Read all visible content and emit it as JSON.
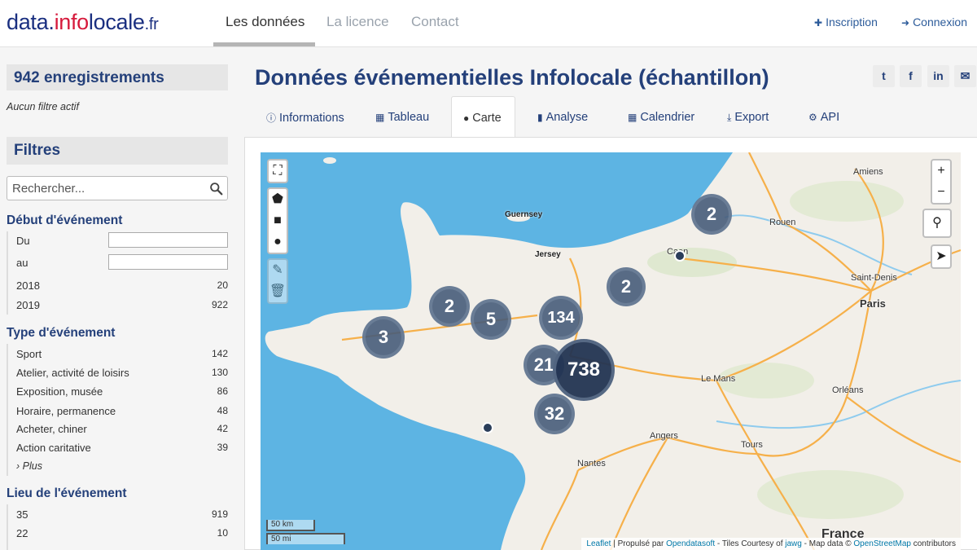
{
  "header": {
    "logo": {
      "part1": "data.",
      "part2": "info",
      "part3": "locale",
      "part4": ".fr"
    },
    "nav": [
      {
        "label": "Les données",
        "active": true
      },
      {
        "label": "La licence",
        "active": false
      },
      {
        "label": "Contact",
        "active": false
      }
    ],
    "account": {
      "signup": "Inscription",
      "login": "Connexion"
    }
  },
  "sidebar": {
    "record_count": "942 enregistrements",
    "no_filter": "Aucun filtre actif",
    "filters_title": "Filtres",
    "search_placeholder": "Rechercher...",
    "start_event": {
      "title": "Début d'événement",
      "from_label": "Du",
      "to_label": "au",
      "years": [
        {
          "label": "2018",
          "count": "20"
        },
        {
          "label": "2019",
          "count": "922"
        }
      ]
    },
    "event_type": {
      "title": "Type d'événement",
      "items": [
        {
          "label": "Sport",
          "count": "142"
        },
        {
          "label": "Atelier, activité de loisirs",
          "count": "130"
        },
        {
          "label": "Exposition, musée",
          "count": "86"
        },
        {
          "label": "Horaire, permanence",
          "count": "48"
        },
        {
          "label": "Acheter, chiner",
          "count": "42"
        },
        {
          "label": "Action caritative",
          "count": "39"
        }
      ],
      "more": "› Plus"
    },
    "event_place": {
      "title": "Lieu de l'événement",
      "items": [
        {
          "label": "35",
          "count": "919"
        },
        {
          "label": "22",
          "count": "10"
        }
      ]
    }
  },
  "main": {
    "title": "Données événementielles Infolocale (échantillon)",
    "social": [
      "twitter-icon",
      "facebook-icon",
      "linkedin-icon",
      "email-icon"
    ],
    "tabs": [
      {
        "label": "Informations",
        "icon": "info-icon"
      },
      {
        "label": "Tableau",
        "icon": "table-icon"
      },
      {
        "label": "Carte",
        "icon": "globe-icon",
        "active": true
      },
      {
        "label": "Analyse",
        "icon": "bar-chart-icon"
      },
      {
        "label": "Calendrier",
        "icon": "calendar-icon"
      },
      {
        "label": "Export",
        "icon": "download-icon"
      },
      {
        "label": "API",
        "icon": "gears-icon"
      }
    ]
  },
  "map": {
    "clusters": [
      {
        "label": "2"
      },
      {
        "label": "2"
      },
      {
        "label": "2"
      },
      {
        "label": "5"
      },
      {
        "label": "134"
      },
      {
        "label": "3"
      },
      {
        "label": "21"
      },
      {
        "label": "738"
      },
      {
        "label": "32"
      }
    ],
    "cities": {
      "amiens": "Amiens",
      "rouen": "Rouen",
      "caen": "Caen",
      "saint_denis": "Saint-Denis",
      "paris": "Paris",
      "le_mans": "Le Mans",
      "orleans": "Orléans",
      "angers": "Angers",
      "tours": "Tours",
      "nantes": "Nantes",
      "france": "France"
    },
    "islands": {
      "guernsey": "Guernsey",
      "jersey": "Jersey"
    },
    "zoom_in": "+",
    "zoom_out": "−",
    "scale_km": "50 km",
    "scale_mi": "50 mi",
    "attribution": {
      "leaflet": "Leaflet",
      "powered": "| Propulsé par",
      "ods": "Opendatasoft",
      "tiles": "- Tiles Courtesy of",
      "jawg": "jawg",
      "mapdata": "- Map data ©",
      "osm": "OpenStreetMap",
      "contrib": "contributors"
    }
  }
}
